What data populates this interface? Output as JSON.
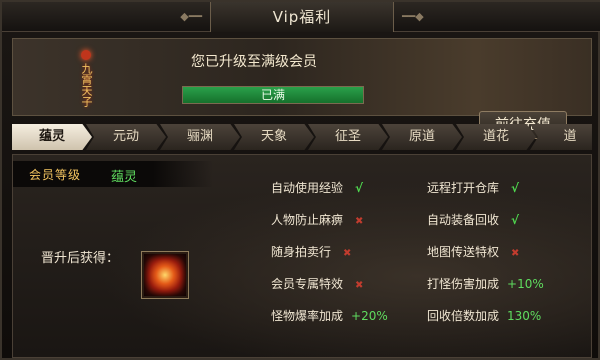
{
  "window": {
    "title": "Vip福利"
  },
  "header": {
    "emblem_text": "九霄天子",
    "status_text": "您已升级至满级会员",
    "progress": {
      "value": 1.0,
      "label": "已满"
    },
    "recharge_button": "前往充值"
  },
  "tabs": [
    {
      "label": "蕴灵",
      "active": true
    },
    {
      "label": "元动",
      "active": false
    },
    {
      "label": "骊渊",
      "active": false
    },
    {
      "label": "天象",
      "active": false
    },
    {
      "label": "征圣",
      "active": false
    },
    {
      "label": "原道",
      "active": false
    },
    {
      "label": "道花",
      "active": false
    },
    {
      "label": "道",
      "active": false
    }
  ],
  "panel": {
    "member_label": "会员等级",
    "member_value": "蕴灵",
    "reward_title": "晋升后获得：",
    "reward_item_icon": "fire-orb-icon",
    "perks": [
      {
        "name": "自动使用经验",
        "status": "check",
        "mark": "√"
      },
      {
        "name": "远程打开仓库",
        "status": "check",
        "mark": "√"
      },
      {
        "name": "人物防止麻痹",
        "status": "cross",
        "mark": "✖"
      },
      {
        "name": "自动装备回收",
        "status": "check",
        "mark": "√"
      },
      {
        "name": "随身拍卖行",
        "status": "cross",
        "mark": "✖"
      },
      {
        "name": "地图传送特权",
        "status": "cross",
        "mark": "✖"
      },
      {
        "name": "会员专属特效",
        "status": "cross",
        "mark": "✖"
      },
      {
        "name": "打怪伤害加成",
        "status": "bonus",
        "mark": "+10%"
      },
      {
        "name": "怪物爆率加成",
        "status": "bonus",
        "mark": "+20%"
      },
      {
        "name": "回收倍数加成",
        "status": "bonus",
        "mark": "130%"
      }
    ]
  },
  "colors": {
    "accent_gold": "#f4c560",
    "check_green": "#4fd84f",
    "cross_red": "#c23c2e",
    "progress_green": "#2aa04a"
  }
}
